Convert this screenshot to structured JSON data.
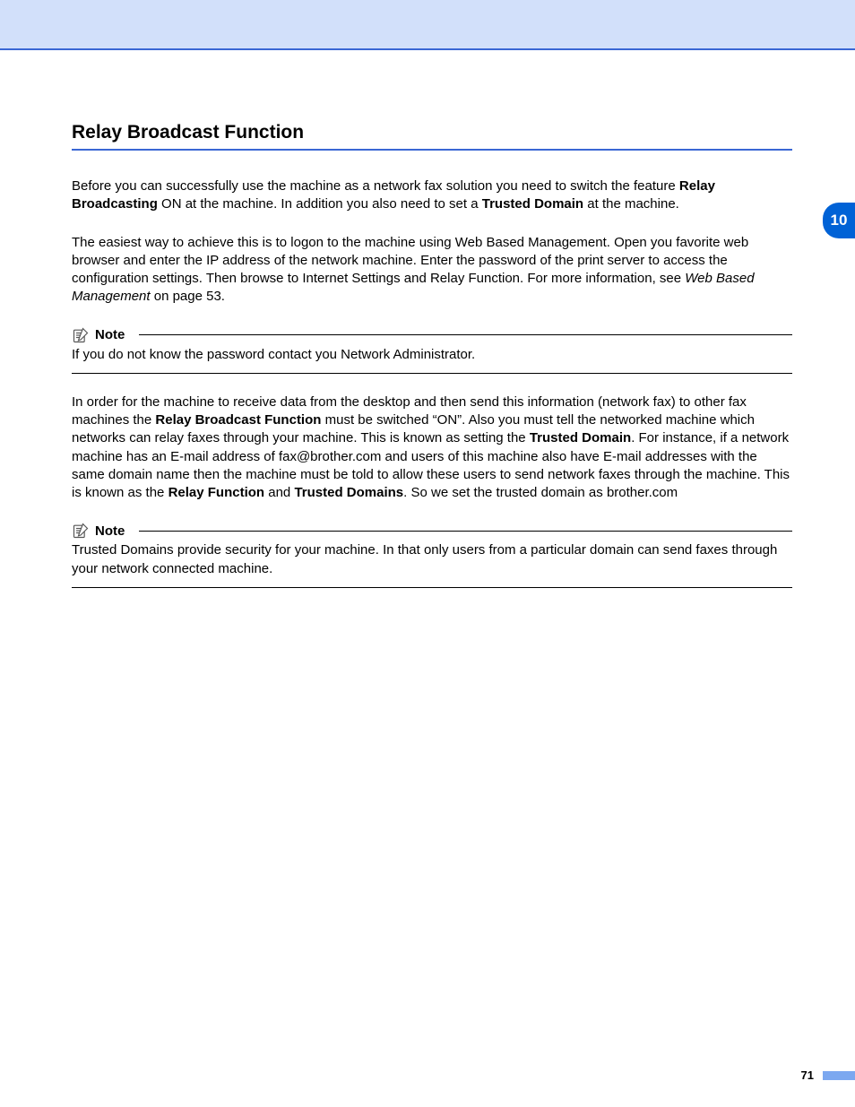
{
  "chapter_tab": "10",
  "page_number": "71",
  "title": "Relay Broadcast Function",
  "p1_a": "Before you can successfully use the machine as a network fax solution you need to switch the feature ",
  "p1_b": "Relay Broadcasting",
  "p1_c": " ON at the machine. In addition you also need to set a ",
  "p1_d": "Trusted Domain",
  "p1_e": " at the machine.",
  "p2_a": "The easiest way to achieve this is to logon to the machine using Web Based Management. Open you favorite web browser and enter the IP address of the network machine. Enter the password of the print server to access the configuration settings. Then browse to Internet Settings and Relay Function. For more information, see ",
  "p2_b": "Web Based Management",
  "p2_c": " on page 53.",
  "note_label": "Note",
  "note1_body": "If you do not know the password contact you Network Administrator.",
  "p3_a": "In order for the machine to receive data from the desktop and then send this information (network fax) to other fax machines the ",
  "p3_b": "Relay Broadcast Function",
  "p3_c": " must be switched “ON”. Also you must tell the networked machine which networks can relay faxes through your machine. This is known as setting the ",
  "p3_d": "Trusted Domain",
  "p3_e": ". For instance, if a network machine has an E-mail address of fax@brother.com and users of this machine also have E-mail addresses with the same domain name then the machine must be told to allow these users to send network faxes through the machine. This is known as the ",
  "p3_f": "Relay Function",
  "p3_g": " and ",
  "p3_h": "Trusted Domains",
  "p3_i": ". So we set the trusted domain as brother.com",
  "note2_body": "Trusted Domains provide security for your machine. In that only users from a particular domain can send faxes through your network connected machine."
}
